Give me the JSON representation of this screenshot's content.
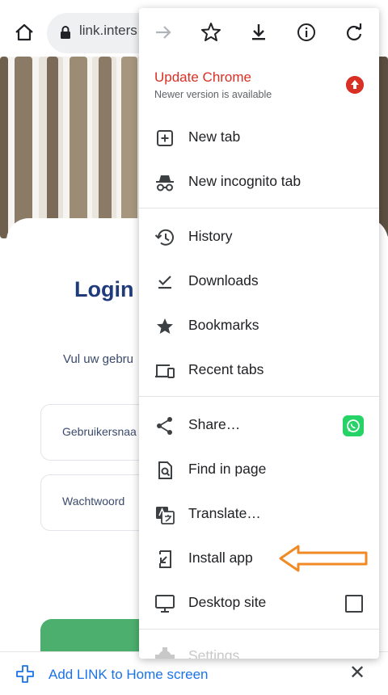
{
  "browser": {
    "url_text": "link.inters",
    "home_icon": "home-icon",
    "lock_icon": "lock-icon"
  },
  "page": {
    "login_title": "Login r",
    "intro_text": "Vul uw gebru",
    "username_label": "Gebruikersnaa",
    "password_label": "Wachtwoord"
  },
  "menu": {
    "toolbar_icons": [
      "forward-icon",
      "bookmark-star-icon",
      "download-icon",
      "info-icon",
      "refresh-icon"
    ],
    "update_title": "Update Chrome",
    "update_subtitle": "Newer version is available",
    "items": [
      {
        "label": "New tab",
        "icon": "new-tab-icon"
      },
      {
        "label": "New incognito tab",
        "icon": "incognito-icon"
      },
      {
        "label": "History",
        "icon": "history-icon"
      },
      {
        "label": "Downloads",
        "icon": "downloads-icon"
      },
      {
        "label": "Bookmarks",
        "icon": "bookmarks-star-icon"
      },
      {
        "label": "Recent tabs",
        "icon": "recent-tabs-icon"
      },
      {
        "label": "Share…",
        "icon": "share-icon"
      },
      {
        "label": "Find in page",
        "icon": "find-in-page-icon"
      },
      {
        "label": "Translate…",
        "icon": "translate-icon"
      },
      {
        "label": "Install app",
        "icon": "install-app-icon"
      },
      {
        "label": "Desktop site",
        "icon": "desktop-icon"
      },
      {
        "label": "Settings",
        "icon": "settings-icon"
      }
    ],
    "desktop_site_checked": false
  },
  "bottom_bar": {
    "add_text": "Add LINK to Home screen",
    "close_label": "✕"
  },
  "colors": {
    "update_red": "#d93025",
    "link_blue": "#1a73e8",
    "title_navy": "#1f3b7a",
    "annotation_orange": "#f08a24",
    "whatsapp_green": "#25d366"
  }
}
